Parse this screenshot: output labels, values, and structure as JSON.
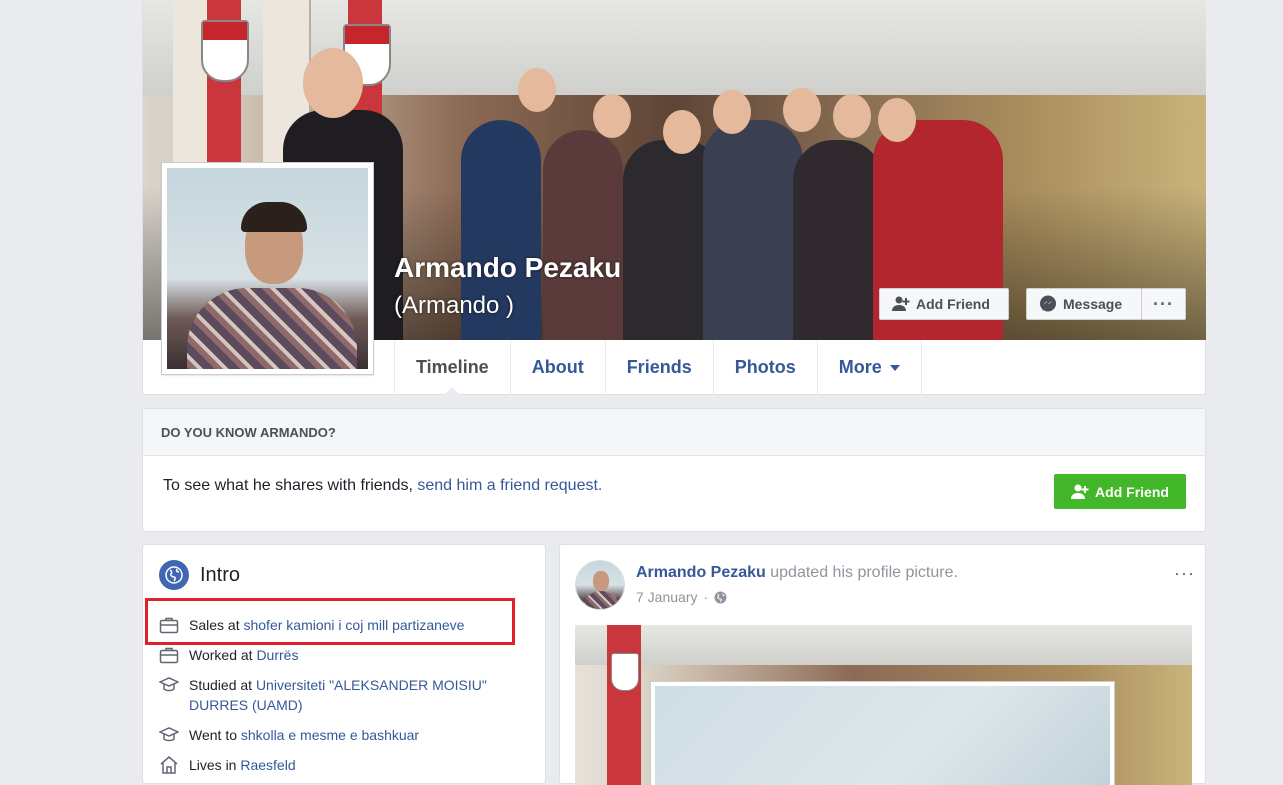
{
  "profile": {
    "name": "Armando Pezaku",
    "alternate_name": "(Armando )"
  },
  "header_buttons": {
    "add_friend": "Add Friend",
    "message": "Message",
    "more": "···"
  },
  "tabs": [
    {
      "label": "Timeline"
    },
    {
      "label": "About"
    },
    {
      "label": "Friends"
    },
    {
      "label": "Photos"
    },
    {
      "label": "More"
    }
  ],
  "know_card": {
    "header": "DO YOU KNOW ARMANDO?",
    "text_prefix": "To see what he shares with friends, ",
    "link": "send him a friend request.",
    "button": "Add Friend"
  },
  "intro": {
    "title": "Intro",
    "items": [
      {
        "icon": "briefcase-icon",
        "prefix": "Sales at ",
        "link": "shofer kamioni i coj mill partizaneve"
      },
      {
        "icon": "briefcase-icon",
        "prefix": "Worked at ",
        "link": "Durrës"
      },
      {
        "icon": "graduation-cap-icon",
        "prefix": "Studied at ",
        "link": "Universiteti \"ALEKSANDER MOISIU\" DURRES (UAMD)"
      },
      {
        "icon": "graduation-cap-icon",
        "prefix": "Went to ",
        "link": "shkolla e mesme e bashkuar"
      },
      {
        "icon": "home-icon",
        "prefix": "Lives in ",
        "link": "Raesfeld"
      }
    ]
  },
  "post": {
    "author": "Armando Pezaku",
    "action": " updated his profile picture.",
    "date": "7 January",
    "separator": "·",
    "more": "···"
  },
  "colors": {
    "link_blue": "#365899",
    "fb_green": "#42b72a",
    "highlight_red": "#e0202b",
    "page_bg": "#e9ebee"
  }
}
